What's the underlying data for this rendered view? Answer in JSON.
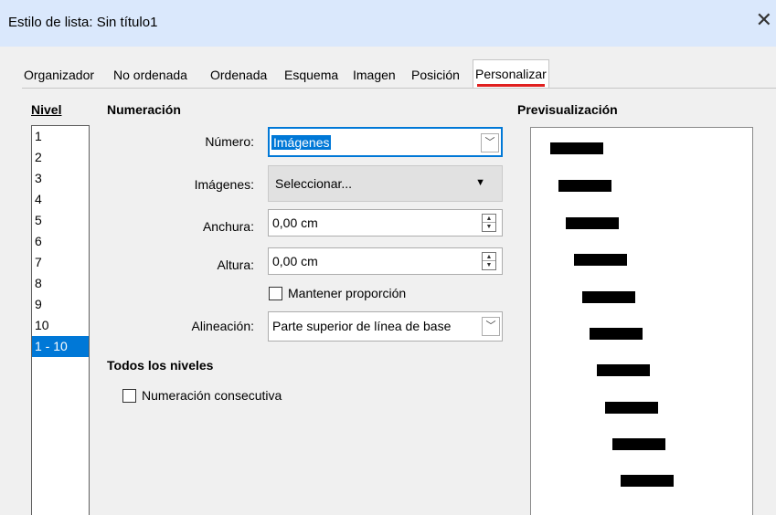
{
  "window": {
    "title": "Estilo de lista: Sin título1",
    "close_icon": "close-icon"
  },
  "tabs": [
    {
      "label": "Organizador"
    },
    {
      "label": "No ordenada"
    },
    {
      "label": "Ordenada"
    },
    {
      "label": "Esquema"
    },
    {
      "label": "Imagen"
    },
    {
      "label": "Posición"
    },
    {
      "label": "Personalizar",
      "active": true
    }
  ],
  "level": {
    "heading": "Nivel",
    "items": [
      "1",
      "2",
      "3",
      "4",
      "5",
      "6",
      "7",
      "8",
      "9",
      "10",
      "1 - 10"
    ],
    "selected": "1 - 10"
  },
  "numbering": {
    "heading": "Numeración",
    "numero_label": "Número:",
    "numero_value": "Imágenes",
    "imagenes_label": "Imágenes:",
    "imagenes_button": "Seleccionar...",
    "anchura_label": "Anchura:",
    "anchura_value": "0,00 cm",
    "altura_label": "Altura:",
    "altura_value": "0,00 cm",
    "keep_ratio_label": "Mantener proporción",
    "alineacion_label": "Alineación:",
    "alineacion_value": "Parte superior de línea de base"
  },
  "all_levels": {
    "heading": "Todos los niveles",
    "consecutive_label": "Numeración consecutiva"
  },
  "preview": {
    "heading": "Previsualización"
  },
  "colors": {
    "accent": "#0078d7",
    "active_tab_underline": "#e0201f",
    "titlebar": "#dae8fc"
  }
}
